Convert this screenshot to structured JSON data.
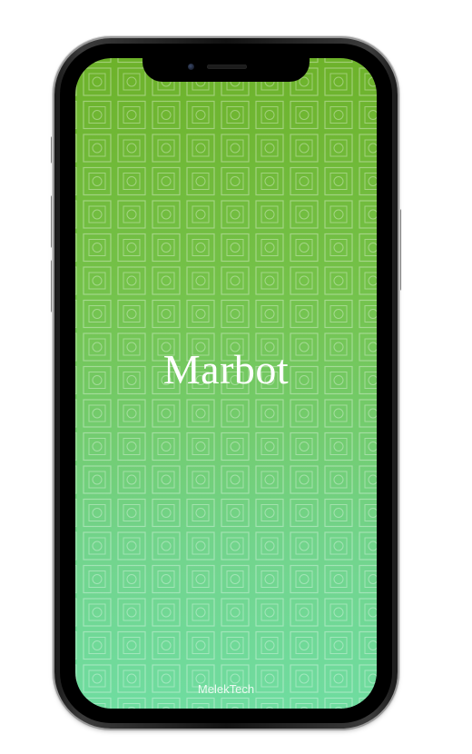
{
  "app": {
    "title": "Marbot",
    "footer_brand": "MelekTech"
  },
  "theme": {
    "gradient_top": "#6db22a",
    "gradient_bottom": "#6fdca0",
    "text_color": "#ffffff"
  },
  "device": {
    "model_icon": "phone-frame-icon"
  }
}
